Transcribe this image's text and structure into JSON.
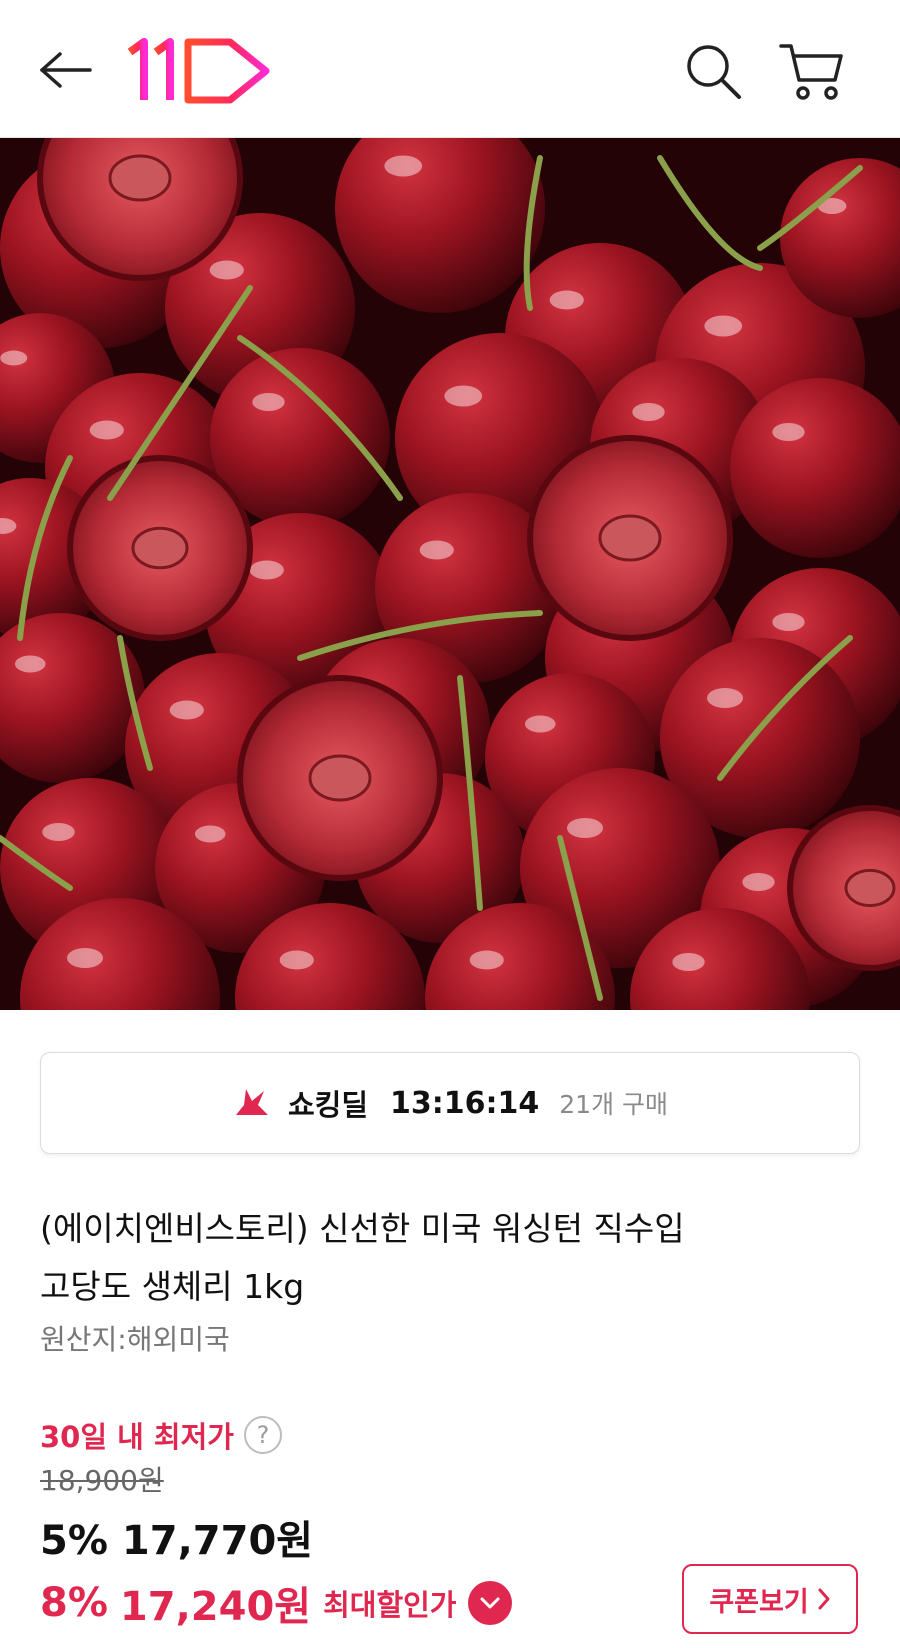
{
  "header": {
    "back_icon": "arrow-left-icon",
    "logo_text": "11",
    "search_icon": "search-icon",
    "cart_icon": "cart-icon"
  },
  "hero": {
    "image_subject": "cherries",
    "slide_count": 4,
    "active_slide": 1
  },
  "deal": {
    "icon": "shocking-deal-icon",
    "label": "쇼킹딜",
    "timer": "13:16:14",
    "purchase_count": "21개 구매"
  },
  "product": {
    "title_line1": "(에이치엔비스토리) 신선한 미국 워싱턴 직수입",
    "title_line2": "고당도 생체리 1kg",
    "origin": "원산지:해외미국"
  },
  "price": {
    "lowest_label": "30일 내 최저가",
    "help_icon": "question-icon",
    "original_price": "18,900원",
    "discount_pct": "5%",
    "sale_price": "17,770원",
    "max_discount_pct": "8%",
    "max_price": "17,240원",
    "max_label": "최대할인가",
    "coupon_label": "쿠폰보기"
  },
  "colors": {
    "accent": "#e0274f",
    "text": "#111111",
    "muted": "#777777"
  }
}
